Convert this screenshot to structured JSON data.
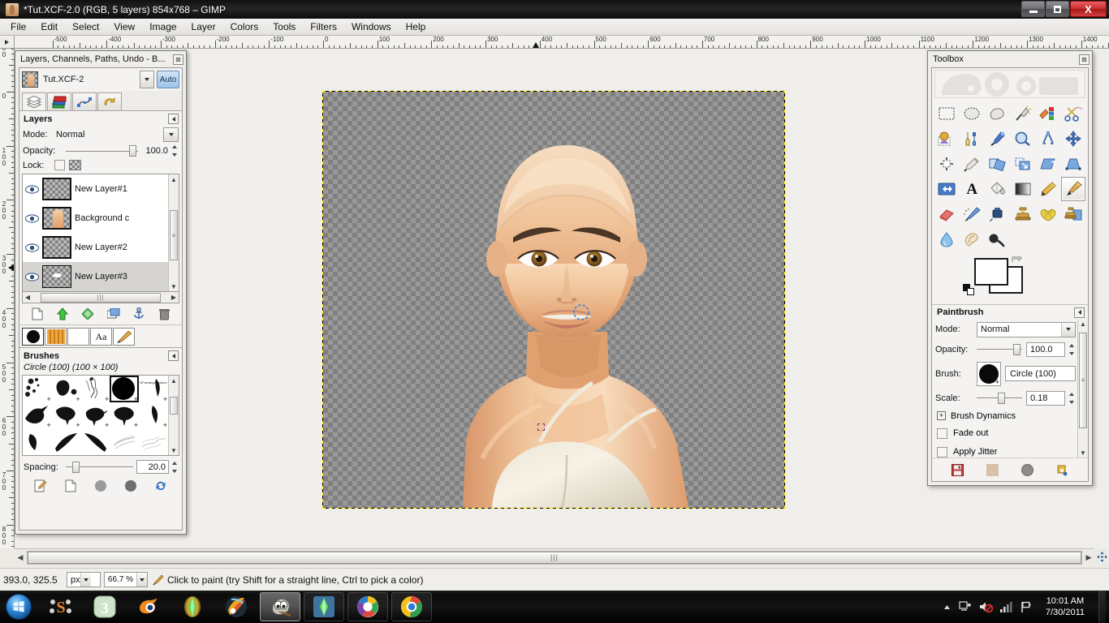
{
  "window": {
    "title": "*Tut.XCF-2.0 (RGB, 5 layers) 854x768 – GIMP",
    "minimize_label": "Minimize",
    "restore_label": "Restore",
    "close_label": "X"
  },
  "menubar": {
    "items": [
      {
        "label": "File",
        "accel": "F"
      },
      {
        "label": "Edit",
        "accel": "E"
      },
      {
        "label": "Select",
        "accel": "S"
      },
      {
        "label": "View",
        "accel": "V"
      },
      {
        "label": "Image",
        "accel": "I"
      },
      {
        "label": "Layer",
        "accel": "L"
      },
      {
        "label": "Colors",
        "accel": "C"
      },
      {
        "label": "Tools",
        "accel": "T"
      },
      {
        "label": "Filters",
        "accel": "r"
      },
      {
        "label": "Windows",
        "accel": "W"
      },
      {
        "label": "Help",
        "accel": "H"
      }
    ]
  },
  "rulers": {
    "horizontal_labels": [
      "-500",
      "-400",
      "-300",
      "-200",
      "-100",
      "0",
      "100",
      "200",
      "300",
      "400",
      "500",
      "600",
      "700",
      "800",
      "900",
      "1000",
      "1100",
      "1200",
      "1300",
      "1400"
    ],
    "vertical_labels": [
      "-100",
      "0",
      "100",
      "200",
      "300",
      "400",
      "500",
      "600",
      "700",
      "800"
    ],
    "unit": "px",
    "h_marker_value": "393",
    "v_marker_value": "325"
  },
  "layers_dock": {
    "title": "Layers, Channels, Paths, Undo - B...",
    "close_label": "⊠",
    "image_name": "Tut.XCF-2",
    "auto_label": "Auto",
    "tabs": [
      {
        "name": "layers-tab",
        "label": "Layers"
      },
      {
        "name": "channels-tab",
        "label": "Channels"
      },
      {
        "name": "paths-tab",
        "label": "Paths"
      },
      {
        "name": "undo-tab",
        "label": "Undo History"
      }
    ],
    "section_title": "Layers",
    "mode_label": "Mode:",
    "mode_value": "Normal",
    "opacity_label": "Opacity:",
    "opacity_value": "100.0",
    "lock_label": "Lock:",
    "layers": [
      {
        "name": "New Layer#1",
        "visible": true,
        "selected": false,
        "kind": "empty"
      },
      {
        "name": "Background c",
        "visible": true,
        "selected": false,
        "kind": "figure"
      },
      {
        "name": "New Layer#2",
        "visible": true,
        "selected": false,
        "kind": "empty"
      },
      {
        "name": "New Layer#3",
        "visible": true,
        "selected": true,
        "kind": "blob"
      }
    ],
    "buttons": [
      {
        "name": "new-layer-button",
        "label": "New Layer"
      },
      {
        "name": "raise-layer-button",
        "label": "Raise Layer"
      },
      {
        "name": "duplicate-layer-button",
        "label": "Duplicate Layer"
      },
      {
        "name": "new-layer-group-button",
        "label": "New Layer Group"
      },
      {
        "name": "anchor-layer-button",
        "label": "Anchor Layer"
      },
      {
        "name": "delete-layer-button",
        "label": "Delete Layer"
      }
    ]
  },
  "brushes_dock": {
    "tabs": [
      {
        "name": "brushes-tab",
        "label": "Brushes"
      },
      {
        "name": "patterns-tab",
        "label": "Patterns"
      },
      {
        "name": "gradients-tab",
        "label": "Gradients"
      },
      {
        "name": "fonts-tab",
        "label": "Aa"
      },
      {
        "name": "tool-presets-tab",
        "label": "Tool Presets"
      }
    ],
    "section_title": "Brushes",
    "selected_brush": "Circle (100) (100 × 100)",
    "brush_watermark": "GFantasyBrushes",
    "spacing_label": "Spacing:",
    "spacing_value": "20.0",
    "buttons": [
      {
        "name": "edit-brush-button",
        "label": "Edit Brush"
      },
      {
        "name": "new-brush-button",
        "label": "New Brush"
      },
      {
        "name": "duplicate-brush-button",
        "label": "Duplicate Brush"
      },
      {
        "name": "delete-brush-button",
        "label": "Delete Brush"
      },
      {
        "name": "refresh-brushes-button",
        "label": "Refresh Brushes"
      }
    ]
  },
  "toolbox": {
    "title": "Toolbox",
    "close_label": "⊠",
    "tools": [
      {
        "name": "rect-select-tool",
        "label": "Rectangle Select"
      },
      {
        "name": "ellipse-select-tool",
        "label": "Ellipse Select"
      },
      {
        "name": "free-select-tool",
        "label": "Free Select"
      },
      {
        "name": "fuzzy-select-tool",
        "label": "Fuzzy Select"
      },
      {
        "name": "by-color-select-tool",
        "label": "Select by Color"
      },
      {
        "name": "scissors-select-tool",
        "label": "Scissors Select"
      },
      {
        "name": "foreground-select-tool",
        "label": "Foreground Select"
      },
      {
        "name": "paths-tool",
        "label": "Paths"
      },
      {
        "name": "color-picker-tool",
        "label": "Color Picker"
      },
      {
        "name": "zoom-tool",
        "label": "Zoom"
      },
      {
        "name": "measure-tool",
        "label": "Measure"
      },
      {
        "name": "move-tool",
        "label": "Move"
      },
      {
        "name": "alignment-tool",
        "label": "Alignment"
      },
      {
        "name": "crop-tool",
        "label": "Crop"
      },
      {
        "name": "rotate-tool",
        "label": "Rotate"
      },
      {
        "name": "scale-tool",
        "label": "Scale"
      },
      {
        "name": "shear-tool",
        "label": "Shear"
      },
      {
        "name": "perspective-tool",
        "label": "Perspective"
      },
      {
        "name": "flip-tool",
        "label": "Flip"
      },
      {
        "name": "text-tool",
        "label": "Text"
      },
      {
        "name": "bucket-fill-tool",
        "label": "Bucket Fill"
      },
      {
        "name": "blend-tool",
        "label": "Blend"
      },
      {
        "name": "pencil-tool",
        "label": "Pencil"
      },
      {
        "name": "paintbrush-tool",
        "label": "Paintbrush",
        "selected": true
      },
      {
        "name": "eraser-tool",
        "label": "Eraser"
      },
      {
        "name": "airbrush-tool",
        "label": "Airbrush"
      },
      {
        "name": "ink-tool",
        "label": "Ink"
      },
      {
        "name": "clone-tool",
        "label": "Clone"
      },
      {
        "name": "heal-tool",
        "label": "Heal"
      },
      {
        "name": "perspective-clone-tool",
        "label": "Perspective Clone"
      },
      {
        "name": "blur-sharpen-tool",
        "label": "Blur / Sharpen"
      },
      {
        "name": "smudge-tool",
        "label": "Smudge"
      },
      {
        "name": "dodge-burn-tool",
        "label": "Dodge / Burn"
      }
    ],
    "foreground_color": "#ffffff",
    "background_color": "#ffffff"
  },
  "tool_options": {
    "title": "Paintbrush",
    "mode_label": "Mode:",
    "mode_value": "Normal",
    "opacity_label": "Opacity:",
    "opacity_value": "100.0",
    "brush_label": "Brush:",
    "brush_value": "Circle (100)",
    "scale_label": "Scale:",
    "scale_value": "0.18",
    "brush_dynamics_label": "Brush Dynamics",
    "fade_out_label": "Fade out",
    "apply_jitter_label": "Apply Jitter",
    "buttons": [
      {
        "name": "save-tool-options-button",
        "label": "Save Options"
      },
      {
        "name": "restore-tool-options-button",
        "label": "Restore Options"
      },
      {
        "name": "delete-tool-options-button",
        "label": "Delete Options"
      },
      {
        "name": "reset-tool-options-button",
        "label": "Reset Options"
      }
    ]
  },
  "statusbar": {
    "position": "393.0, 325.5",
    "unit": "px",
    "zoom": "66.7 %",
    "hint": "Click to paint (try Shift for a straight line, Ctrl to pick a color)"
  },
  "taskbar": {
    "start_label": "Start",
    "apps": [
      {
        "name": "taskbar-sculptris",
        "label": "Sculptris"
      },
      {
        "name": "taskbar-milkshape3d",
        "label": "3"
      },
      {
        "name": "taskbar-blender",
        "label": "Blender"
      },
      {
        "name": "taskbar-sims3-launcher",
        "label": "The Sims 3 Launcher"
      },
      {
        "name": "taskbar-fl-studio",
        "label": "FL Studio"
      },
      {
        "name": "taskbar-gimp",
        "label": "GIMP",
        "active": true
      },
      {
        "name": "taskbar-sims3",
        "label": "The Sims 3"
      },
      {
        "name": "taskbar-picasa",
        "label": "Picasa"
      },
      {
        "name": "taskbar-chrome",
        "label": "Google Chrome"
      }
    ],
    "tray": [
      {
        "name": "show-hidden-icons-button",
        "label": "Show hidden icons"
      },
      {
        "name": "network-icon",
        "label": "Network"
      },
      {
        "name": "volume-muted-icon",
        "label": "Volume muted"
      },
      {
        "name": "signal-icon",
        "label": "Signal strength"
      },
      {
        "name": "action-center-icon",
        "label": "Action Center"
      }
    ],
    "time": "10:01 AM",
    "date": "7/30/2011"
  },
  "colors": {
    "title_bar": "#0d0d0d",
    "accent_blue": "#9cc4ea",
    "selection_yellow": "#ffe800",
    "panel_bg": "#f0eeea",
    "skin": "#e8b98f"
  }
}
